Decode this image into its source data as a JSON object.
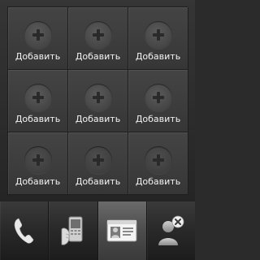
{
  "speed_dial": {
    "slots": [
      {
        "label": "Добавить"
      },
      {
        "label": "Добавить"
      },
      {
        "label": "Добавить"
      },
      {
        "label": "Добавить"
      },
      {
        "label": "Добавить"
      },
      {
        "label": "Добавить"
      },
      {
        "label": "Добавить"
      },
      {
        "label": "Добавить"
      },
      {
        "label": "Добавить"
      }
    ]
  },
  "tabbar": {
    "tabs": [
      {
        "icon": "phone-handset-icon"
      },
      {
        "icon": "mobile-phone-recent-icon"
      },
      {
        "icon": "contact-card-icon",
        "active": true
      },
      {
        "icon": "person-remove-icon"
      }
    ]
  }
}
